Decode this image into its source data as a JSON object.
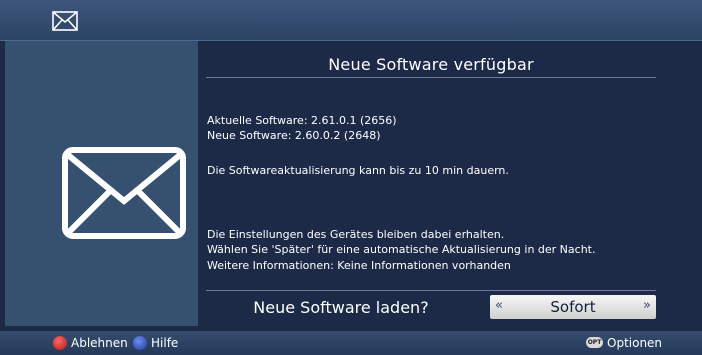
{
  "header": {
    "icon": "envelope-icon"
  },
  "sidebar": {
    "icon": "envelope-icon"
  },
  "dialog": {
    "title": "Neue Software verfügbar",
    "current_software": "Aktuelle Software: 2.61.0.1 (2656)",
    "new_software": "Neue Software: 2.60.0.2 (2648)",
    "duration_note": "Die Softwareaktualisierung kann bis zu 10 min dauern.",
    "settings_note": "Die Einstellungen des Gerätes bleiben dabei erhalten.",
    "later_note": "Wählen Sie 'Später' für eine automatische Aktualisierung in der Nacht.",
    "more_info": "Weitere Informationen: Keine Informationen vorhanden",
    "question": "Neue Software laden?",
    "selector": {
      "value": "Sofort",
      "left_arrow": "«",
      "right_arrow": "»"
    }
  },
  "footer": {
    "reject_label": "Ablehnen",
    "help_label": "Hilfe",
    "options_badge": "OPT",
    "options_label": "Optionen"
  },
  "colors": {
    "background": "#1c2a48",
    "left_panel": "#36506f",
    "red_button": "#d01c1c",
    "blue_button": "#2c4bb0"
  }
}
